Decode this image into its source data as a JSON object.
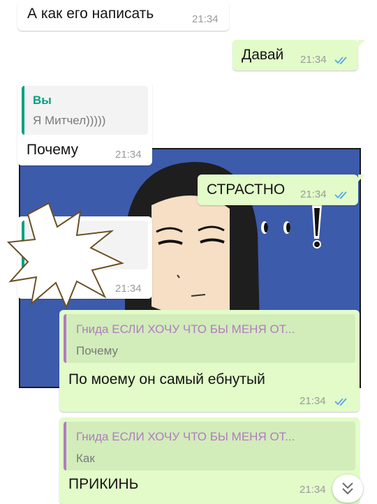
{
  "messages": [
    {
      "text": "А как его написать",
      "time": "21:34"
    },
    {
      "text": "Давай",
      "time": "21:34"
    },
    {
      "quote_author": "Вы",
      "quote_text": "Я Митчел)))))",
      "text": "Почему",
      "time": "21:34"
    },
    {
      "text": "СТРАСТНО",
      "time": "21:34"
    },
    {
      "time": "21:34"
    },
    {
      "quote_author": "Гнида ЕСЛИ ХОЧУ ЧТО БЫ МЕНЯ ОТ...",
      "quote_text": "Почему",
      "text": "По моему он самый ебнутый",
      "time": "21:34"
    },
    {
      "quote_author": "Гнида ЕСЛИ ХОЧУ ЧТО БЫ МЕНЯ ОТ...",
      "quote_text": "Как",
      "text": "ПРИКИНЬ",
      "time": "21:34"
    }
  ],
  "colors": {
    "incoming_bubble": "#ffffff",
    "outgoing_bubble": "#e2fbc9",
    "read_ticks": "#4fa3e6",
    "own_quote_author": "#06a084",
    "contact_quote_author": "#b07cc0",
    "comic_background": "#3c5bab"
  },
  "icons": {
    "read_status": "double-check-icon",
    "scroll_down": "double-chevron-down-icon",
    "comic_overlay": "comic-illustration"
  }
}
